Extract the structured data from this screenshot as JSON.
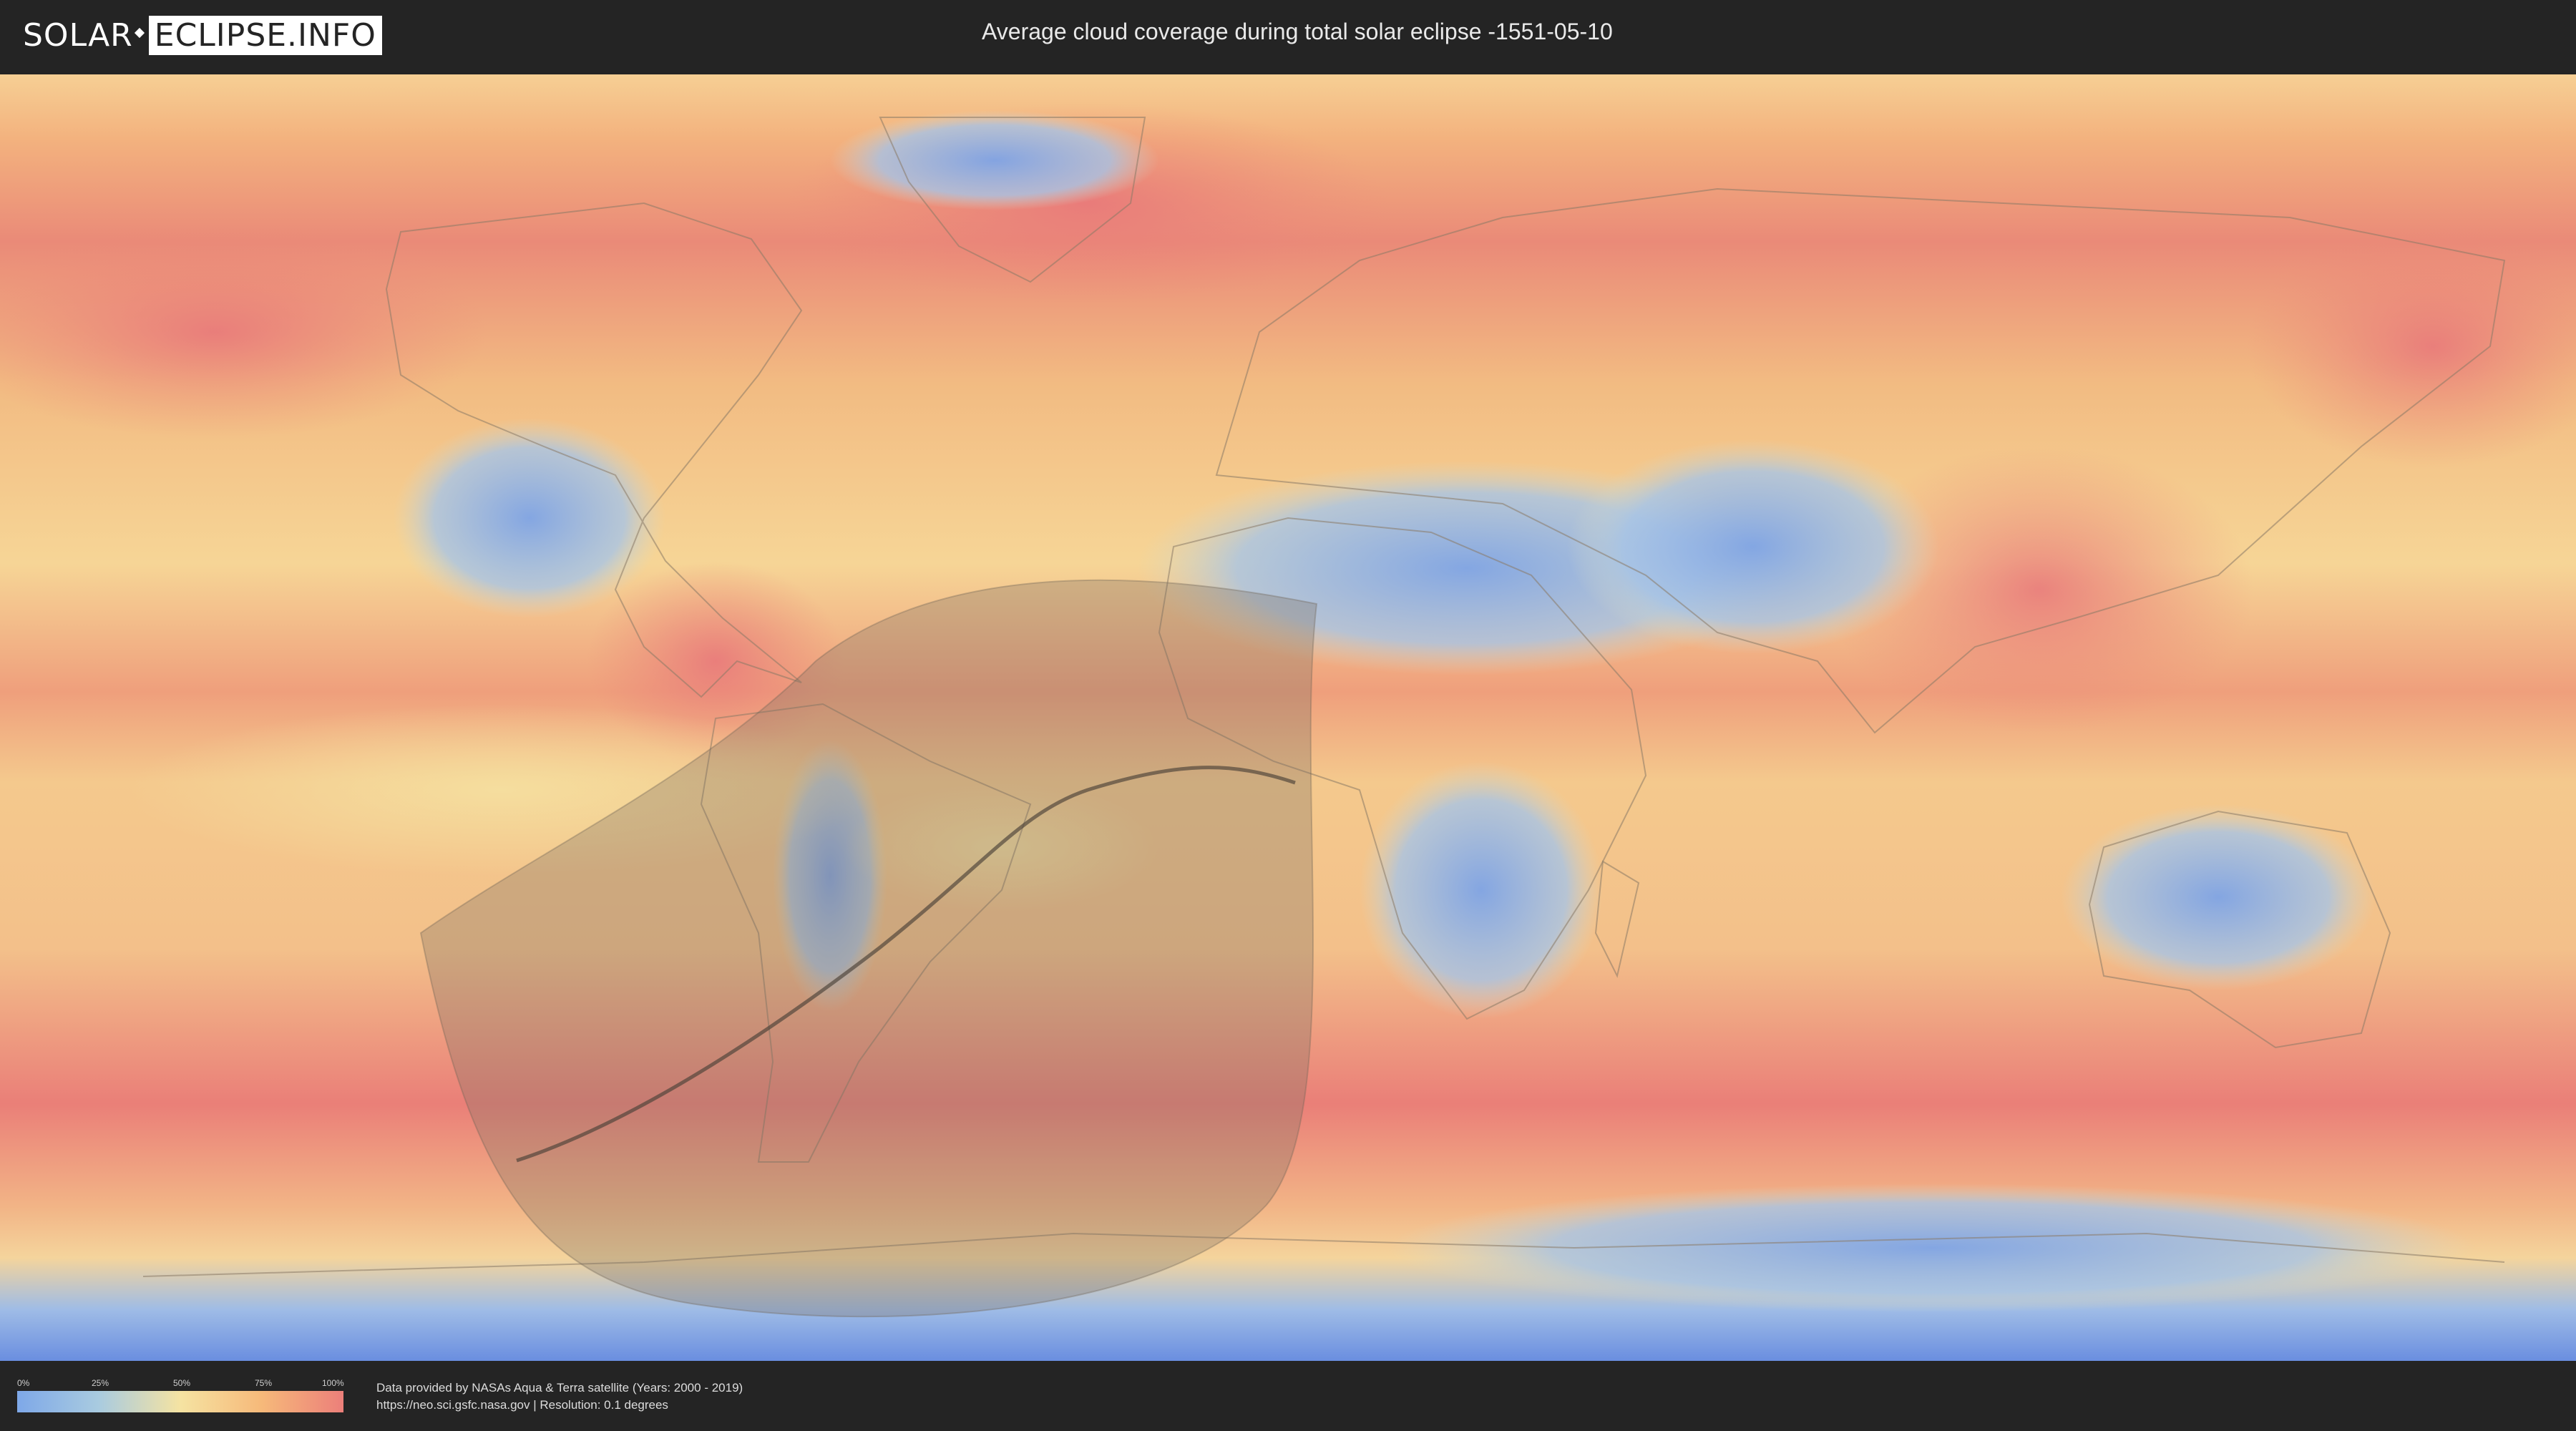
{
  "header": {
    "logo_part1": "SOLAR",
    "logo_part2": "ECLIPSE.INFO",
    "title": "Average cloud coverage during total solar eclipse -1551-05-10"
  },
  "map": {
    "layers": [
      "cloud-coverage-raster",
      "country-borders",
      "eclipse-visibility-area",
      "path-of-totality"
    ],
    "colors": {
      "clear": "#7ea8e8",
      "low": "#a9cbe0",
      "mid": "#f5e3a2",
      "high": "#f6b97a",
      "overcast": "#ec7f7a",
      "eclipse_shadow": "#7d7062",
      "path_line": "#4a4038"
    }
  },
  "legend": {
    "ticks": [
      "0%",
      "25%",
      "50%",
      "75%",
      "100%"
    ]
  },
  "footer": {
    "credit_line1": "Data provided by NASAs Aqua & Terra satellite (Years: 2000 - 2019)",
    "credit_line2": "https://neo.sci.gsfc.nasa.gov | Resolution: 0.1 degrees"
  }
}
